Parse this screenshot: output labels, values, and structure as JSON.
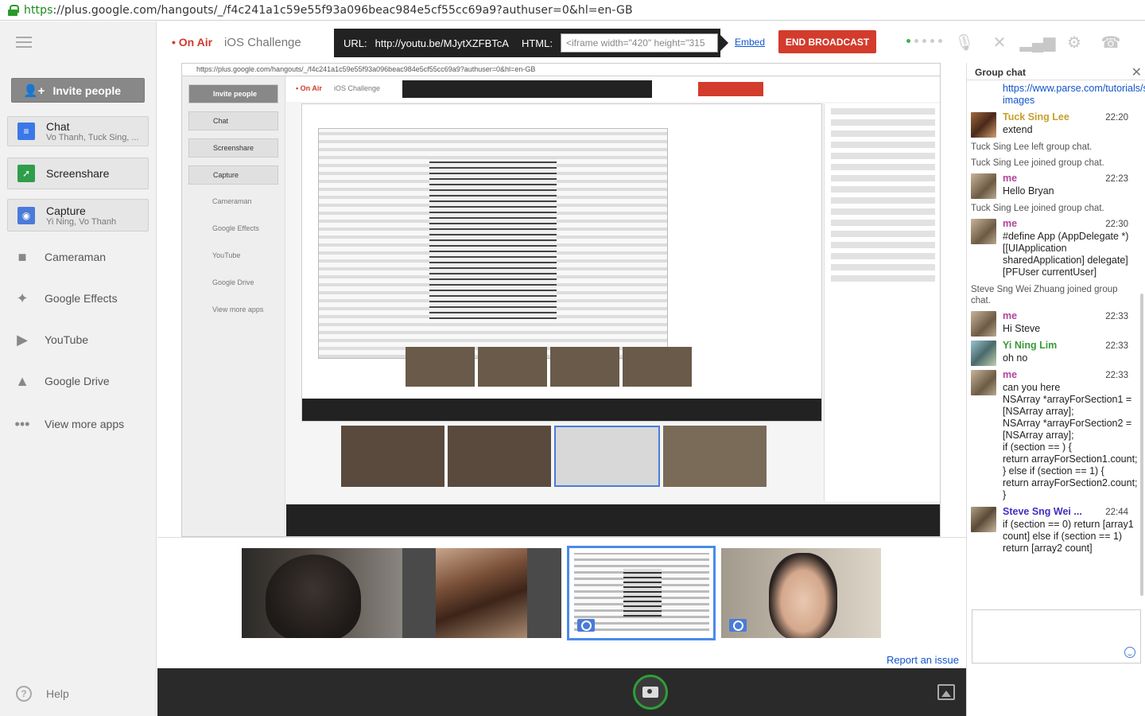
{
  "browser": {
    "url_scheme": "https",
    "url_rest": "://plus.google.com/hangouts/_/f4c241a1c59e55f93a096beac984e5cf55cc69a9?authuser=0&hl=en-GB"
  },
  "sidebar": {
    "invite_label": "Invite people",
    "apps": [
      {
        "label": "Chat",
        "sub": "Vo Thanh, Tuck Sing, ..."
      },
      {
        "label": "Screenshare",
        "sub": ""
      },
      {
        "label": "Capture",
        "sub": "Yi Ning, Vo Thanh"
      }
    ],
    "more_apps": [
      {
        "label": "Cameraman",
        "icon": "video-camera-icon"
      },
      {
        "label": "Google Effects",
        "icon": "effects-icon"
      },
      {
        "label": "YouTube",
        "icon": "youtube-icon"
      },
      {
        "label": "Google Drive",
        "icon": "drive-icon"
      },
      {
        "label": "View more apps",
        "icon": "more-dots-icon"
      }
    ],
    "help_label": "Help"
  },
  "toolbar": {
    "on_air": "• On Air",
    "title": "iOS Challenge",
    "url_label": "URL:",
    "url_value": "http://youtu.be/MJytXZFBTcA",
    "html_label": "HTML:",
    "embed_value": "<iframe width=\"420\" height=\"315",
    "embed_link": "Embed",
    "end_broadcast": "END BROADCAST"
  },
  "stage": {
    "mini_url": "https://plus.google.com/hangouts/_/f4c241a1c59e55f93a096beac984e5cf55cc69a9?authuser=0&hl=en-GB",
    "mini_on_air": "• On Air",
    "mini_title": "iOS Challenge",
    "mini_side": [
      "Invite people",
      "Chat",
      "Screenshare",
      "Capture",
      "Cameraman",
      "Google Effects",
      "YouTube",
      "Google Drive",
      "View more apps"
    ]
  },
  "filmstrip": {
    "report_issue": "Report an issue"
  },
  "chat": {
    "title": "Group chat",
    "close": "✕",
    "link": "https://www.parse.com/tutorials/saving-images",
    "entries": [
      {
        "kind": "msg",
        "who": "tuck",
        "name": "Tuck Sing Lee",
        "time": "22:20",
        "text": "extend"
      },
      {
        "kind": "sys",
        "text": "Tuck Sing Lee left group chat."
      },
      {
        "kind": "sys",
        "text": "Tuck Sing Lee joined group chat."
      },
      {
        "kind": "msg",
        "who": "me",
        "name": "me",
        "time": "22:23",
        "text": "Hello Bryan"
      },
      {
        "kind": "sys",
        "text": "Tuck Sing Lee joined group chat."
      },
      {
        "kind": "msg",
        "who": "me",
        "name": "me",
        "time": "22:30",
        "text": "#define App (AppDelegate *)[[UIApplication sharedApplication] delegate]\n[PFUser currentUser]"
      },
      {
        "kind": "sys",
        "text": "Steve Sng Wei Zhuang joined group chat."
      },
      {
        "kind": "msg",
        "who": "me",
        "name": "me",
        "time": "22:33",
        "text": "Hi Steve"
      },
      {
        "kind": "msg",
        "who": "yining",
        "name": "Yi Ning Lim",
        "time": "22:33",
        "text": "oh no"
      },
      {
        "kind": "msg",
        "who": "me",
        "name": "me",
        "time": "22:33",
        "text": "can you here\nNSArray *arrayForSection1 = [NSArray array];\nNSArray *arrayForSection2 = [NSArray array];\nif (section == ) {\nreturn arrayForSection1.count;\n} else if (section == 1) {\nreturn arrayForSection2.count;\n}"
      },
      {
        "kind": "msg",
        "who": "steve",
        "name": "Steve Sng Wei ...",
        "time": "22:44",
        "text": "if (section == 0) return [array1 count] else if (section == 1) return [array2 count]"
      }
    ]
  },
  "colors": {
    "on_air": "#d23a2a",
    "end_broadcast": "#d33b2c",
    "link": "#1155cc",
    "selected_thumb_border": "#4a8bea",
    "snap_ring": "#2e9e3a"
  }
}
